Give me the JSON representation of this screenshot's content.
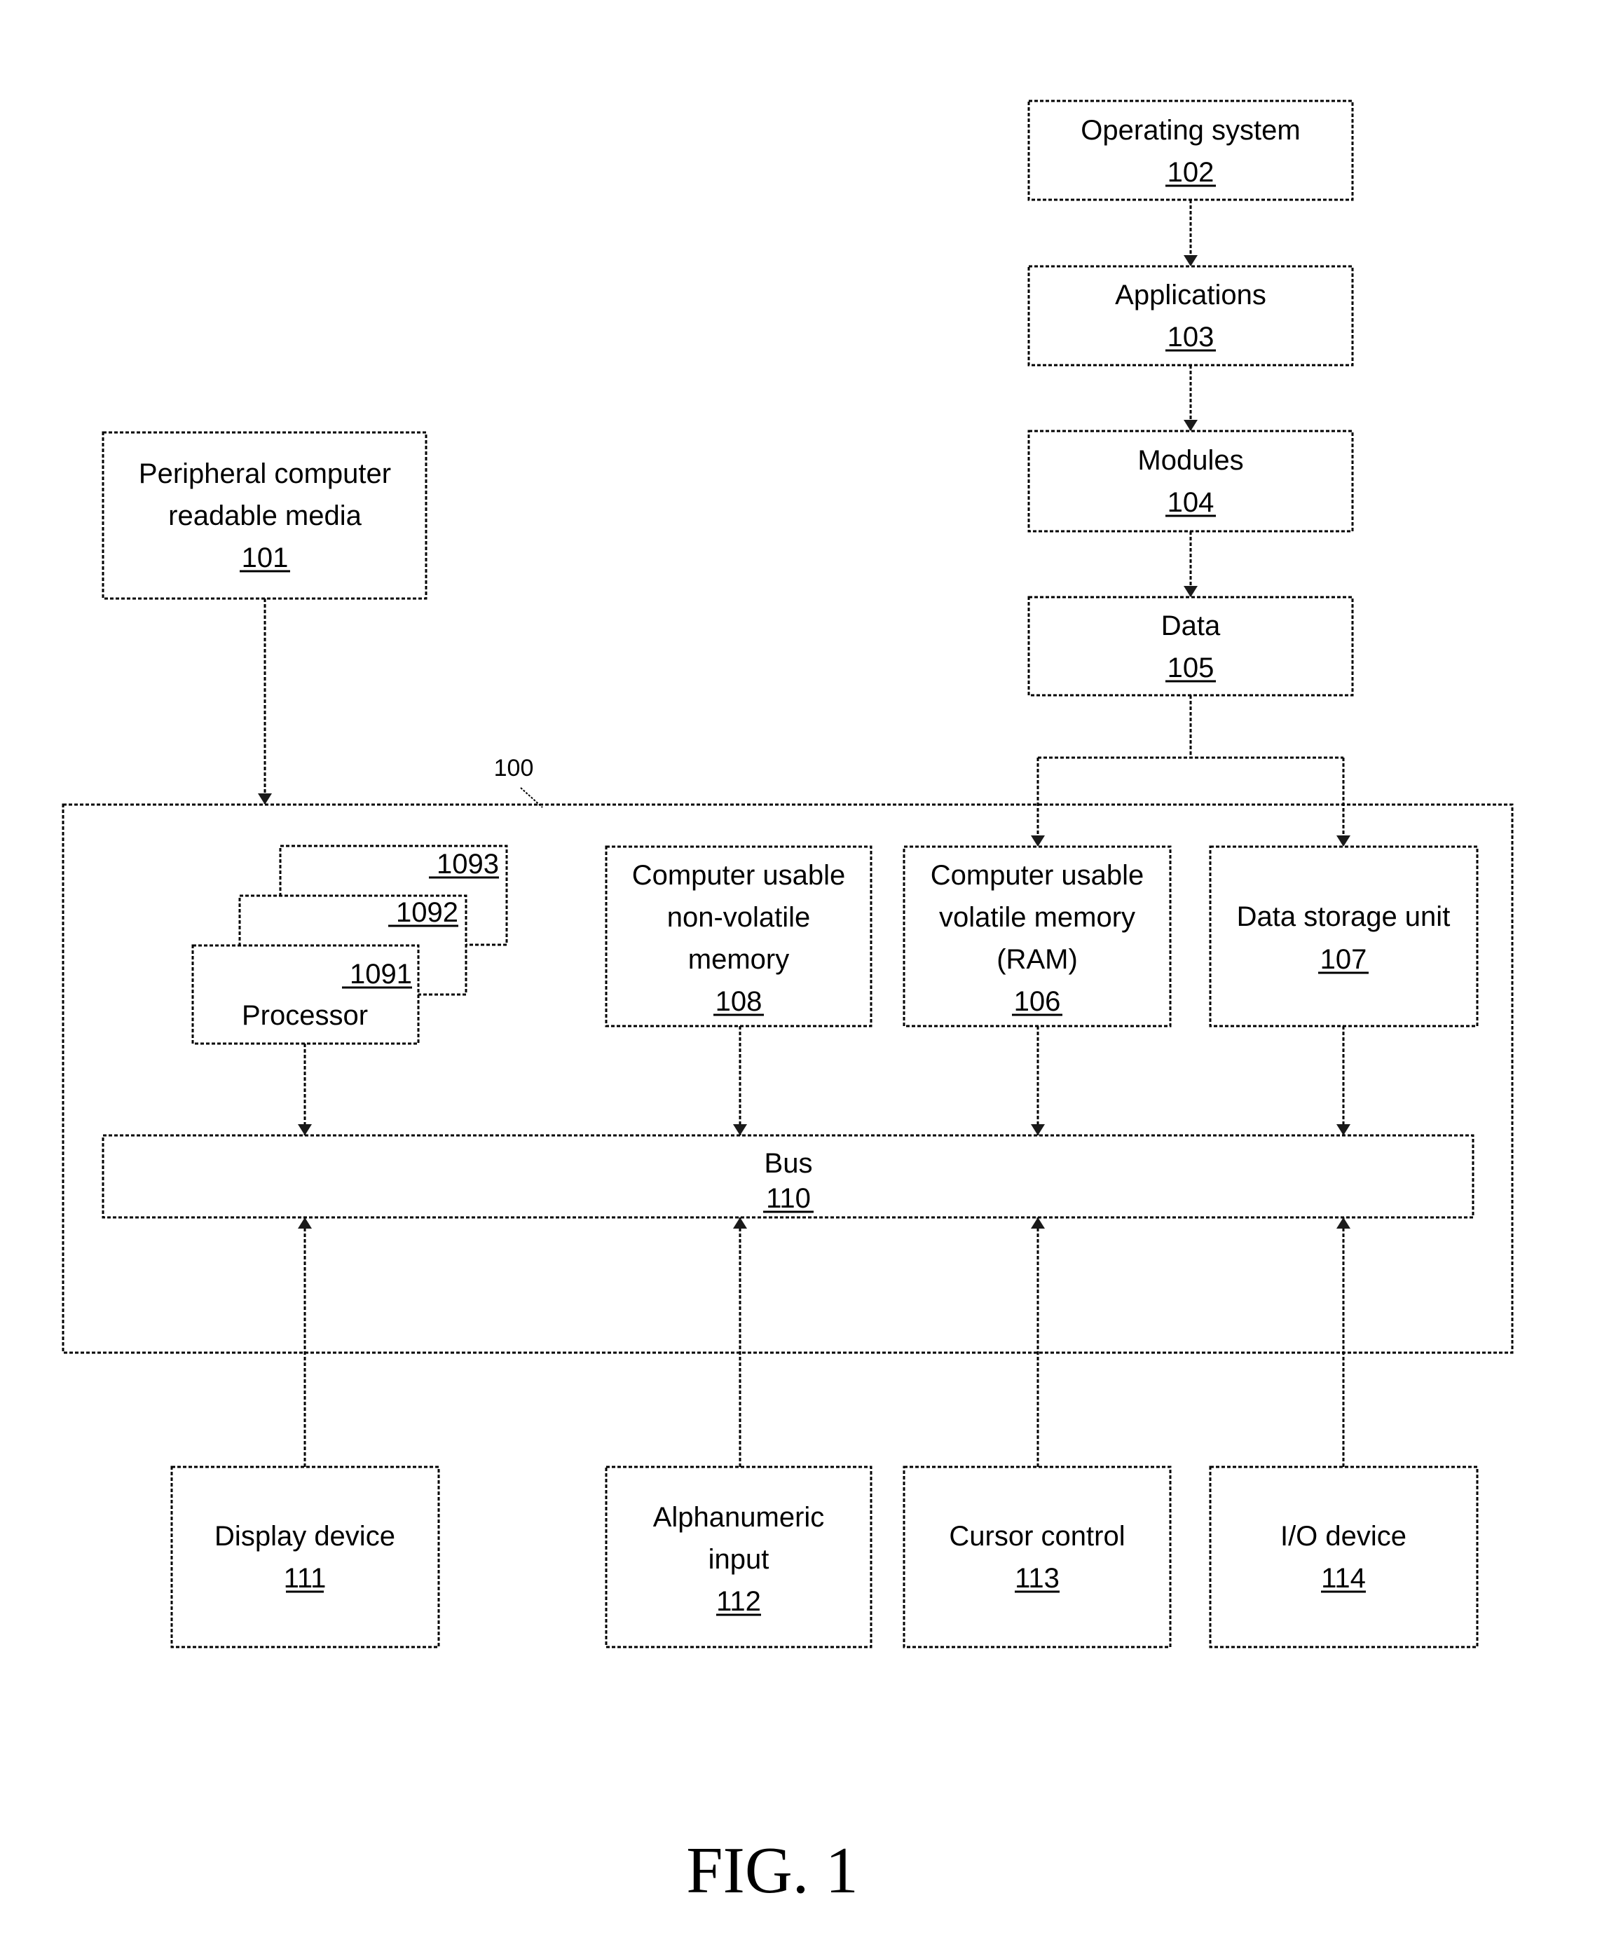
{
  "figure": {
    "caption": "FIG. 1",
    "system_ref": "100"
  },
  "software_stack": [
    {
      "lines": [
        "Operating system"
      ],
      "ref": "102"
    },
    {
      "lines": [
        "Applications"
      ],
      "ref": "103"
    },
    {
      "lines": [
        "Modules"
      ],
      "ref": "104"
    },
    {
      "lines": [
        "Data"
      ],
      "ref": "105"
    }
  ],
  "peripheral": {
    "lines": [
      "Peripheral computer",
      "readable media"
    ],
    "ref": "101"
  },
  "processors": {
    "label": "Processor",
    "refs": [
      "1091",
      "1092",
      "1093"
    ]
  },
  "memory": [
    {
      "lines": [
        "Computer usable",
        "non-volatile",
        "memory"
      ],
      "ref": "108"
    },
    {
      "lines": [
        "Computer usable",
        "volatile memory",
        "(RAM)"
      ],
      "ref": "106"
    },
    {
      "lines": [
        "Data storage unit"
      ],
      "ref": "107"
    }
  ],
  "bus": {
    "lines": [
      "Bus"
    ],
    "ref": "110"
  },
  "io_devices": [
    {
      "lines": [
        "Display device"
      ],
      "ref": "111"
    },
    {
      "lines": [
        "Alphanumeric",
        "input"
      ],
      "ref": "112"
    },
    {
      "lines": [
        "Cursor control"
      ],
      "ref": "113"
    },
    {
      "lines": [
        "I/O device"
      ],
      "ref": "114"
    }
  ]
}
